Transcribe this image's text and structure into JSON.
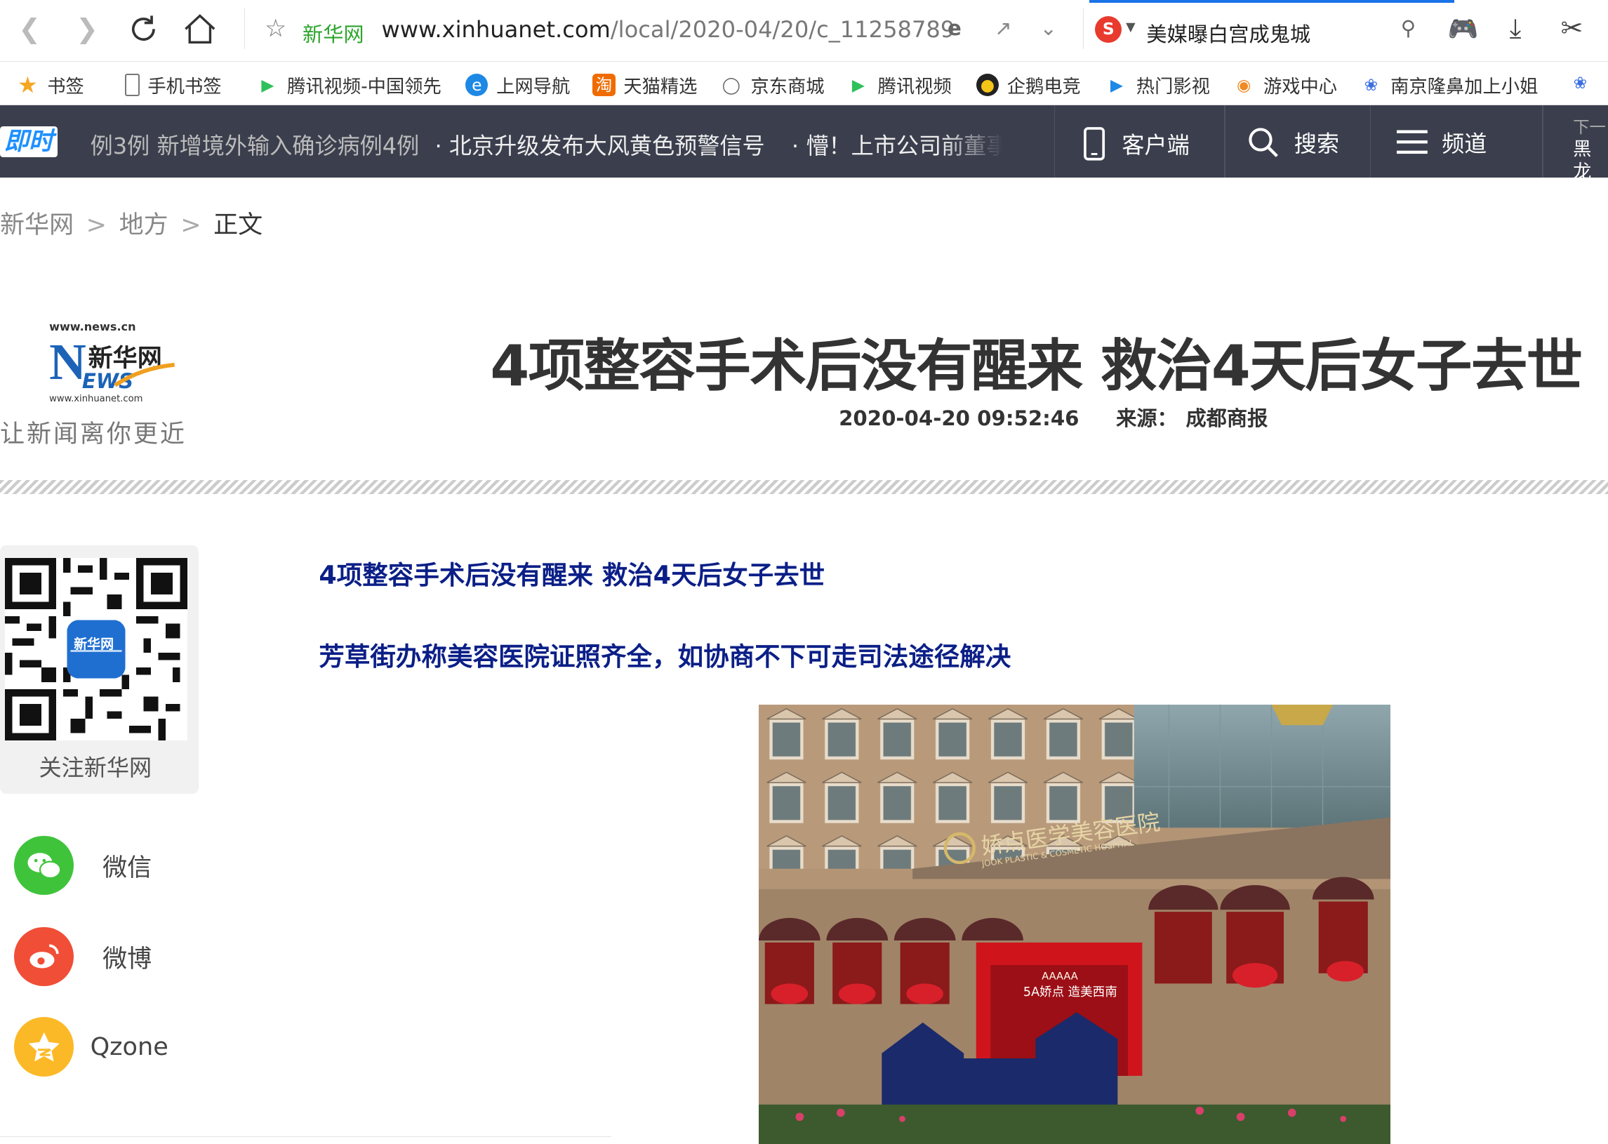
{
  "browser": {
    "site_label": "新华网",
    "url_main": "www.xinhuanet.com",
    "url_path": "/local/2020-04/20/c_11258789",
    "search_query": "美媒曝白宫成鬼城"
  },
  "bookmarks": [
    "书签",
    "手机书签",
    "腾讯视频-中国领先",
    "上网导航",
    "天猫精选",
    "京东商城",
    "腾讯视频",
    "企鹅电竞",
    "热门影视",
    "游戏中心",
    "南京隆鼻加上小姐"
  ],
  "newsbar": {
    "logo": "即时",
    "ticker": [
      "例3例 新增境外输入确诊病例4例",
      "· 北京升级发布大风黄色预警信号",
      "· 懵！上市公司前董事"
    ],
    "client": "客户端",
    "search": "搜索",
    "channel": "频道",
    "next_label": "下一",
    "next_text": "黑龙"
  },
  "breadcrumb": {
    "home": "新华网",
    "section": "地方",
    "current": "正文",
    "sep": ">"
  },
  "header": {
    "logo_url_top": "www.news.cn",
    "logo_cn": "新华网",
    "logo_url_bottom": "www.xinhuanet.com",
    "slogan": "让新闻离你更近",
    "title": "4项整容手术后没有醒来 救治4天后女子去世",
    "datetime": "2020-04-20 09:52:46",
    "source_label": "来源：",
    "source": "成都商报"
  },
  "sidebar": {
    "qr_badge": "新华网",
    "qr_label": "关注新华网",
    "share": [
      {
        "label": "微信",
        "icon": "wechat-icon",
        "color": "#3fc33b"
      },
      {
        "label": "微博",
        "icon": "weibo-icon",
        "color": "#f04e37"
      },
      {
        "label": "Qzone",
        "icon": "qzone-icon",
        "color": "#fcb927"
      }
    ]
  },
  "article": {
    "subtitle1": "4项整容手术后没有醒来 救治4天后女子去世",
    "subtitle2": "芳草街办称美容医院证照齐全，如协商不下可走司法途径解决",
    "photo_sign_cn": "娇点医学美容医院",
    "photo_sign_en": "JOOK PLASTIC & COSMETIC HOSPITAL",
    "photo_banner_top": "AAAAA",
    "photo_banner": "5A娇点 造美西南"
  }
}
